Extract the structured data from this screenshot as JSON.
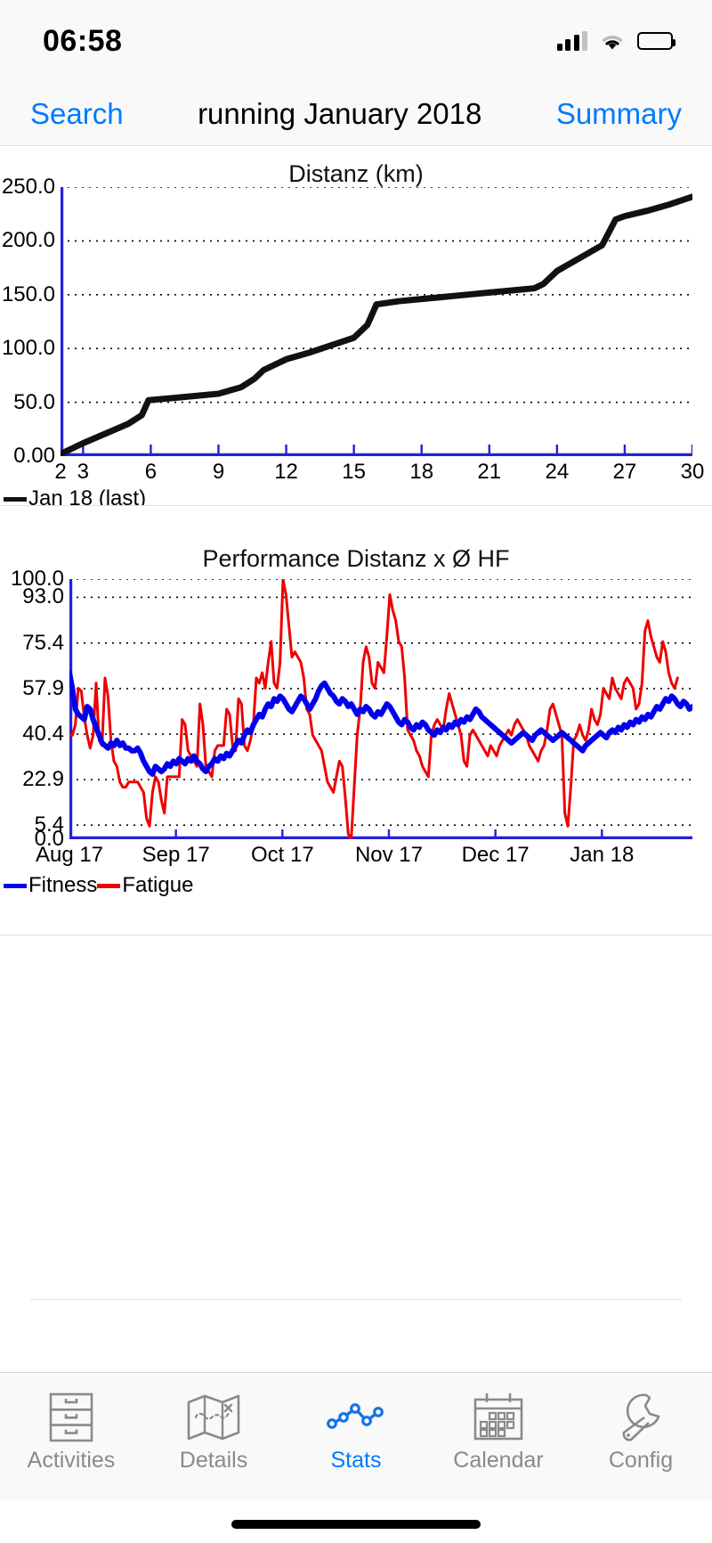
{
  "status_bar": {
    "time": "06:58",
    "signal_icon": "cellular-signal-icon",
    "wifi_icon": "wifi-icon",
    "battery_icon": "battery-icon"
  },
  "nav": {
    "left_label": "Search",
    "title": "running January 2018",
    "right_label": "Summary"
  },
  "chart_data": [
    {
      "type": "line",
      "title": "Distanz (km)",
      "xlabel": "",
      "ylabel": "",
      "ylim": [
        0,
        250
      ],
      "yticks": [
        "0.00",
        "50.0",
        "100.0",
        "150.0",
        "200.0",
        "250.0"
      ],
      "ytick_values": [
        0,
        50,
        100,
        150,
        200,
        250
      ],
      "xticks": [
        "2",
        "3",
        "6",
        "9",
        "12",
        "15",
        "18",
        "21",
        "24",
        "27",
        "30"
      ],
      "xtick_values": [
        2,
        3,
        6,
        9,
        12,
        15,
        18,
        21,
        24,
        27,
        30
      ],
      "xlim": [
        2,
        30
      ],
      "grid": true,
      "legend_position": "below-left",
      "series": [
        {
          "name": "Jan 18 (last)",
          "color": "#111111",
          "x": [
            2,
            3,
            4,
            5,
            5.6,
            5.9,
            7,
            8,
            9,
            10,
            10.6,
            11,
            12,
            13,
            14,
            15,
            15.6,
            16,
            17,
            18,
            19,
            20,
            21,
            22,
            23,
            23.4,
            24,
            25,
            26,
            26.6,
            27,
            28,
            29,
            30
          ],
          "y": [
            2,
            12,
            21,
            30,
            38,
            52,
            54,
            56,
            58,
            64,
            72,
            80,
            90,
            96,
            103,
            110,
            122,
            141,
            144,
            146,
            148,
            150,
            152,
            154,
            156,
            160,
            172,
            184,
            196,
            220,
            223,
            228,
            234,
            241
          ]
        }
      ]
    },
    {
      "type": "line",
      "title": "Performance Distanz x Ø HF",
      "xlabel": "",
      "ylabel": "",
      "ylim": [
        0,
        100
      ],
      "yticks": [
        "0.0",
        "5.4",
        "22.9",
        "40.4",
        "57.9",
        "75.4",
        "93.0",
        "100.0"
      ],
      "ytick_values": [
        0.0,
        5.4,
        22.9,
        40.4,
        57.9,
        75.4,
        93.0,
        100.0
      ],
      "gridline_values": [
        5.4,
        22.9,
        40.4,
        57.9,
        75.4,
        93.0,
        100.0
      ],
      "xticks": [
        "Aug 17",
        "Sep 17",
        "Oct 17",
        "Nov 17",
        "Dec 17",
        "Jan 18"
      ],
      "xtick_values": [
        0,
        1,
        2,
        3,
        4,
        5
      ],
      "xlim": [
        0,
        5.85
      ],
      "grid": true,
      "legend_position": "below-left",
      "series": [
        {
          "name": "Fitness",
          "color": "#0000ee",
          "values": [
            64,
            58,
            50,
            48,
            47,
            46,
            51,
            50,
            46,
            43,
            40,
            37,
            36,
            35,
            37,
            36,
            38,
            36,
            37,
            35,
            35,
            34,
            34,
            35,
            33,
            30,
            28,
            26,
            25,
            28,
            27,
            26,
            27,
            29,
            28,
            30,
            29,
            31,
            30,
            29,
            31,
            30,
            32,
            30,
            29,
            27,
            26,
            28,
            29,
            31,
            30,
            32,
            31,
            33,
            32,
            34,
            36,
            38,
            37,
            40,
            42,
            41,
            44,
            46,
            48,
            47,
            50,
            52,
            51,
            54,
            53,
            55,
            54,
            52,
            50,
            49,
            51,
            53,
            55,
            54,
            52,
            50,
            52,
            54,
            57,
            59,
            60,
            58,
            56,
            55,
            53,
            52,
            54,
            53,
            51,
            52,
            50,
            48,
            50,
            49,
            51,
            50,
            48,
            47,
            49,
            48,
            50,
            52,
            51,
            49,
            47,
            45,
            44,
            46,
            45,
            43,
            42,
            44,
            43,
            45,
            44,
            42,
            41,
            40,
            42,
            41,
            43,
            42,
            44,
            43,
            45,
            44,
            46,
            45,
            47,
            46,
            48,
            50,
            49,
            47,
            46,
            45,
            44,
            43,
            42,
            41,
            40,
            39,
            38,
            37,
            38,
            39,
            40,
            41,
            40,
            39,
            38,
            40,
            41,
            42,
            41,
            40,
            39,
            38,
            39,
            40,
            41,
            40,
            39,
            38,
            37,
            36,
            35,
            34,
            36,
            37,
            38,
            39,
            40,
            41,
            40,
            39,
            41,
            42,
            41,
            43,
            42,
            44,
            43,
            45,
            44,
            46,
            45,
            47,
            46,
            48,
            47,
            49,
            51,
            50,
            52,
            54,
            53,
            55,
            54,
            52,
            51,
            53,
            52,
            50,
            51
          ]
        },
        {
          "name": "Fatigue",
          "color": "#ee0000",
          "values": [
            40,
            40,
            44,
            58,
            57,
            47,
            40,
            35,
            40,
            60,
            38,
            36,
            62,
            55,
            38,
            30,
            28,
            22,
            20,
            20,
            22,
            22,
            22,
            22,
            20,
            18,
            8,
            5,
            18,
            24,
            22,
            15,
            10,
            24,
            24,
            24,
            24,
            24,
            46,
            44,
            34,
            32,
            30,
            28,
            52,
            44,
            28,
            26,
            24,
            34,
            36,
            36,
            36,
            50,
            48,
            36,
            34,
            54,
            52,
            36,
            34,
            38,
            44,
            62,
            60,
            64,
            58,
            68,
            76,
            60,
            58,
            68,
            100,
            94,
            82,
            70,
            72,
            70,
            68,
            62,
            50,
            48,
            40,
            38,
            36,
            34,
            28,
            22,
            20,
            18,
            24,
            30,
            28,
            16,
            2,
            0,
            20,
            40,
            50,
            68,
            74,
            70,
            60,
            58,
            68,
            66,
            64,
            78,
            94,
            88,
            84,
            76,
            74,
            62,
            42,
            40,
            38,
            34,
            32,
            28,
            26,
            24,
            40,
            44,
            46,
            44,
            42,
            50,
            56,
            52,
            48,
            44,
            40,
            30,
            28,
            40,
            42,
            40,
            38,
            36,
            34,
            32,
            36,
            34,
            32,
            36,
            38,
            40,
            42,
            40,
            44,
            46,
            44,
            42,
            40,
            36,
            34,
            32,
            30,
            34,
            36,
            42,
            50,
            52,
            48,
            44,
            40,
            10,
            5,
            20,
            38,
            40,
            44,
            40,
            38,
            42,
            50,
            46,
            44,
            48,
            58,
            56,
            54,
            62,
            58,
            56,
            54,
            60,
            62,
            60,
            58,
            50,
            52,
            60,
            80,
            84,
            78,
            74,
            70,
            68,
            76,
            72,
            64,
            60,
            58,
            62
          ]
        }
      ]
    }
  ],
  "tabbar": {
    "items": [
      {
        "label": "Activities",
        "icon": "filing-cabinet-icon",
        "active": false
      },
      {
        "label": "Details",
        "icon": "map-icon",
        "active": false
      },
      {
        "label": "Stats",
        "icon": "line-chart-icon",
        "active": true
      },
      {
        "label": "Calendar",
        "icon": "calendar-icon",
        "active": false
      },
      {
        "label": "Config",
        "icon": "wrench-icon",
        "active": false
      }
    ],
    "active_color": "#007aff",
    "inactive_color": "#8a8a8e"
  },
  "home_indicator": "home-indicator"
}
